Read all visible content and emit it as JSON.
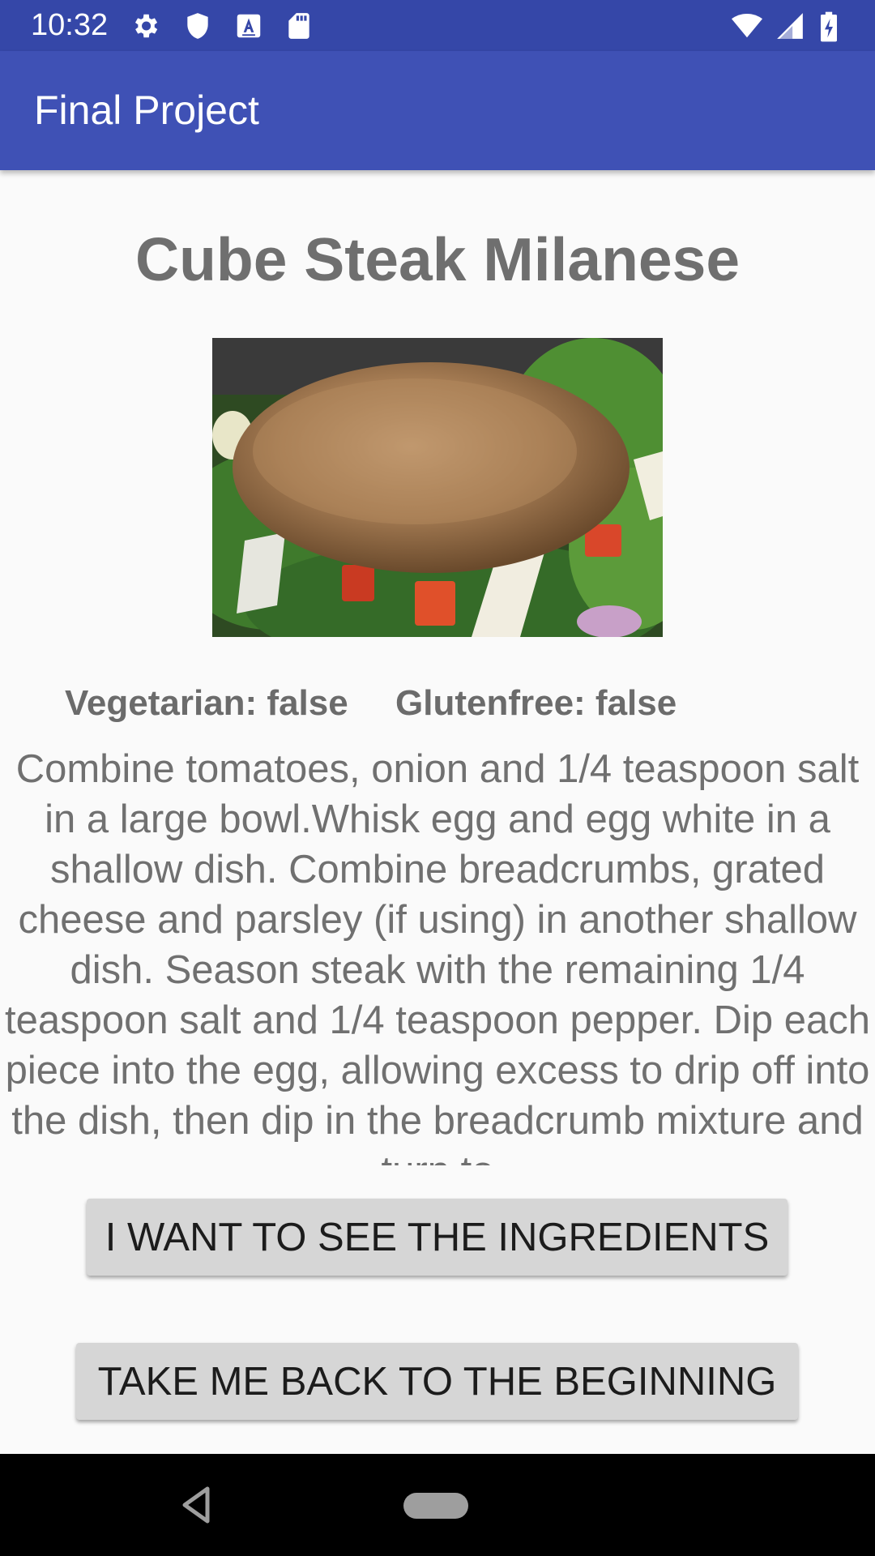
{
  "status_bar": {
    "time": "10:32",
    "icons_left": [
      "gear-icon",
      "shield-icon",
      "a-box-icon",
      "sd-card-icon"
    ],
    "icons_right": [
      "wifi-icon",
      "cell-signal-icon",
      "battery-icon"
    ]
  },
  "app_bar": {
    "title": "Final Project",
    "color": "#3f51b5"
  },
  "recipe": {
    "title": "Cube Steak Milanese",
    "image_alt": "cube-steak-milanese-photo",
    "vegetarian_label": "Vegetarian: false",
    "glutenfree_label": "Glutenfree: false",
    "instructions": "Combine tomatoes, onion and 1/4 teaspoon salt in a large bowl.Whisk egg and egg white in a shallow dish. Combine breadcrumbs, grated cheese and parsley (if using) in another shallow dish. Season steak with the remaining 1/4 teaspoon salt and 1/4 teaspoon pepper. Dip each piece into the egg, allowing excess to drip off into the dish, then dip in the breadcrumb mixture and turn to"
  },
  "buttons": {
    "ingredients": "I WANT TO SEE THE INGREDIENTS",
    "back": "TAKE ME BACK TO THE BEGINNING"
  },
  "nav_bar": {
    "icons": [
      "back-triangle-icon",
      "home-pill-icon"
    ]
  }
}
